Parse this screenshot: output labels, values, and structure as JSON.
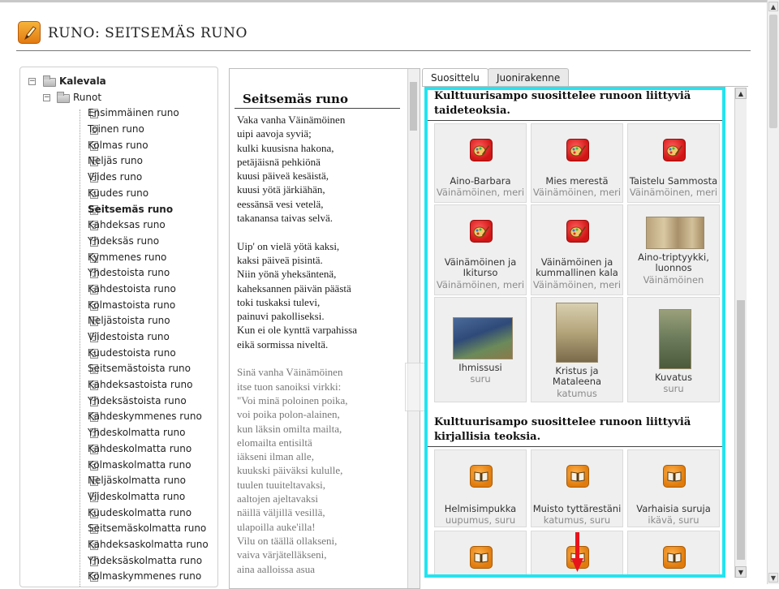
{
  "header": {
    "title": "RUNO: SEITSEMÄS RUNO",
    "icon": "pencil-icon"
  },
  "tree": {
    "root": "Kalevala",
    "folder": "Runot",
    "items": [
      "Ensimmäinen runo",
      "Toinen runo",
      "Kolmas runo",
      "Neljäs runo",
      "Viides runo",
      "Kuudes runo",
      "Seitsemäs runo",
      "Kahdeksas runo",
      "Yhdeksäs runo",
      "Kymmenes runo",
      "Yhdestoista runo",
      "Kahdestoista runo",
      "Kolmastoista runo",
      "Neljästoista runo",
      "Viidestoista runo",
      "Kuudestoista runo",
      "Seitsemästoista runo",
      "Kahdeksastoista runo",
      "Yhdeksästoista runo",
      "Kahdeskymmenes runo",
      "Yhdeskolmatta runo",
      "Kahdeskolmatta runo",
      "Kolmaskolmatta runo",
      "Neljäskolmatta runo",
      "Viideskolmatta runo",
      "Kuudeskolmatta runo",
      "Seitsemäskolmatta runo",
      "Kahdeksaskolmatta runo",
      "Yhdeksäskolmatta runo",
      "Kolmaskymmenes runo"
    ],
    "selected_index": 6
  },
  "poem": {
    "title": "Seitsemäs runo",
    "stanzas": [
      [
        "Vaka vanha Väinämöinen",
        "uipi aavoja syviä;",
        "kulki kuusisna hakona,",
        "petäjäisnä pehkiönä",
        "kuusi päiveä kesäistä,",
        "kuusi yötä järkiähän,",
        "eessänsä vesi vetelä,",
        "takanansa taivas selvä."
      ],
      [
        "Uip' on vielä yötä kaksi,",
        "kaksi päiveä pisintä.",
        "Niin yönä yheksäntenä,",
        "kaheksannen päivän päästä",
        "toki tuskaksi tulevi,",
        "painuvi pakolliseksi.",
        "Kun ei ole kynttä varpahissa",
        "eikä sormissa niveltä."
      ],
      [
        "Sinä vanha Väinämöinen",
        "itse tuon sanoiksi virkki:",
        "\"Voi minä poloinen poika,",
        "voi poika polon-alainen,",
        "kun läksin omilta mailta,",
        "elomailta entisiltä",
        "iäkseni ilman alle,",
        "kuukski päiväksi kululle,",
        "tuulen tuuiteltavaksi,",
        "aaltojen ajeltavaksi",
        "näillä väljillä vesillä,",
        "ulapoilla auke'illa!",
        "Vilu on täällä ollakseni,",
        "vaiva värjätelläkseni,",
        "aina aalloissa asua"
      ]
    ]
  },
  "tabs": [
    {
      "label": "Suosittelu",
      "active": true
    },
    {
      "label": "Juonirakenne",
      "active": false
    }
  ],
  "recommend": {
    "art_heading": "Kulttuurisampo suosittelee runoon liittyviä taideteoksia.",
    "art_items": [
      {
        "title": "Aino-Barbara",
        "tags": "Väinämöinen, meri",
        "icon": "palette-icon"
      },
      {
        "title": "Mies merestä",
        "tags": "Väinämöinen, meri",
        "icon": "palette-icon"
      },
      {
        "title": "Taistelu Sammosta",
        "tags": "Väinämöinen, meri",
        "icon": "palette-icon"
      },
      {
        "title": "Väinämöinen ja Ikiturso",
        "tags": "Väinämöinen, meri",
        "icon": "palette-icon"
      },
      {
        "title": "Väinämöinen ja kummallinen kala",
        "tags": "Väinämöinen, meri",
        "icon": "palette-icon"
      },
      {
        "title": "Aino-triptyykki, luonnos",
        "tags": "Väinämöinen",
        "icon": "painting-thumbnail"
      },
      {
        "title": "Ihmissusi",
        "tags": "suru",
        "icon": "painting-thumbnail"
      },
      {
        "title": "Kristus ja Mataleena",
        "tags": "katumus",
        "icon": "painting-thumbnail"
      },
      {
        "title": "Kuvatus",
        "tags": "suru",
        "icon": "painting-thumbnail"
      }
    ],
    "lit_heading": "Kulttuurisampo suosittelee runoon liittyviä kirjallisia teoksia.",
    "lit_items": [
      {
        "title": "Helmisimpukka",
        "tags": "uupumus, suru",
        "icon": "book-icon"
      },
      {
        "title": "Muisto tyttärestäni",
        "tags": "katumus, suru",
        "icon": "book-icon"
      },
      {
        "title": "Varhaisia suruja",
        "tags": "ikävä, suru",
        "icon": "book-icon"
      },
      {
        "title": "",
        "tags": "",
        "icon": "book-icon"
      },
      {
        "title": "",
        "tags": "",
        "icon": "book-icon"
      },
      {
        "title": "",
        "tags": "",
        "icon": "book-icon"
      }
    ]
  },
  "colors": {
    "highlight_outline": "#22e4f0",
    "arrow": "#e8141c"
  }
}
